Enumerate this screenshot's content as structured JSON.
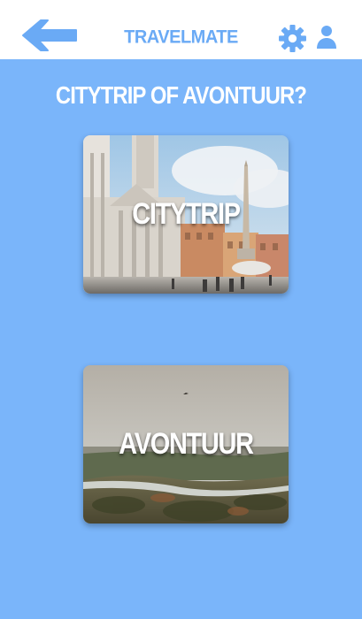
{
  "header": {
    "title": "TRAVELMATE",
    "back_icon": "arrow-left-icon",
    "settings_icon": "gear-icon",
    "profile_icon": "user-icon",
    "accent_color": "#6aaaf5"
  },
  "main": {
    "question": "CITYTRIP OF AVONTUUR?",
    "background_color": "#7ab5fa",
    "options": [
      {
        "label": "CITYTRIP"
      },
      {
        "label": "AVONTUUR"
      }
    ]
  }
}
